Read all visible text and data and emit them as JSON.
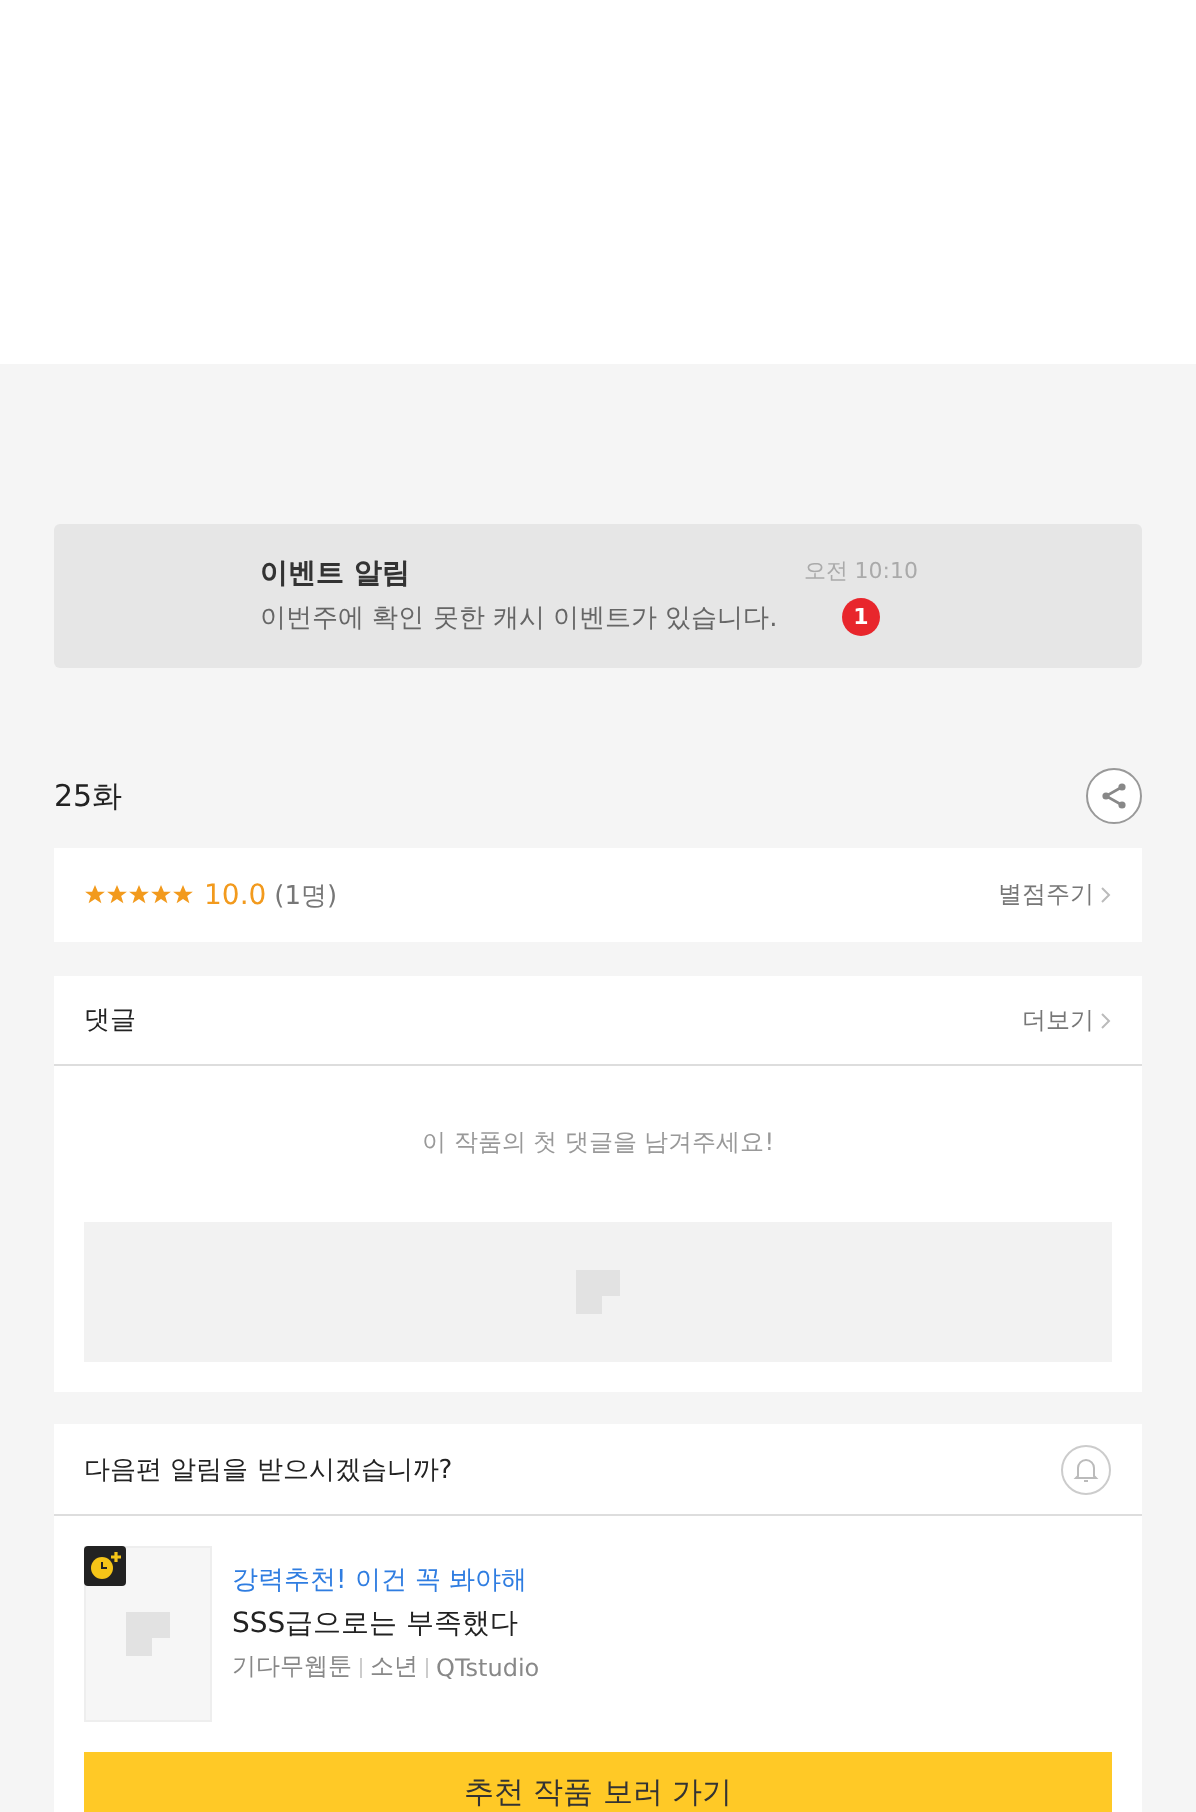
{
  "notice": {
    "title": "이벤트 알림",
    "message": "이번주에 확인 못한 캐시 이벤트가 있습니다.",
    "time": "오전 10:10",
    "badge": "1"
  },
  "episode": {
    "title": "25화"
  },
  "rating": {
    "stars": 5,
    "score": "10.0",
    "count": "(1명)",
    "action": "별점주기"
  },
  "comments": {
    "title": "댓글",
    "more": "더보기",
    "empty_message": "이 작품의 첫 댓글을 남겨주세요!"
  },
  "alert": {
    "question": "다음편 알림을 받으시겠습니까?"
  },
  "recommendation": {
    "tagline": "강력추천! 이건 꼭 봐야해",
    "title": "SSS급으로는 부족했다",
    "meta": [
      "기다무웹툰",
      "소년",
      "QTstudio"
    ],
    "button": "추천 작품 보러 가기"
  }
}
